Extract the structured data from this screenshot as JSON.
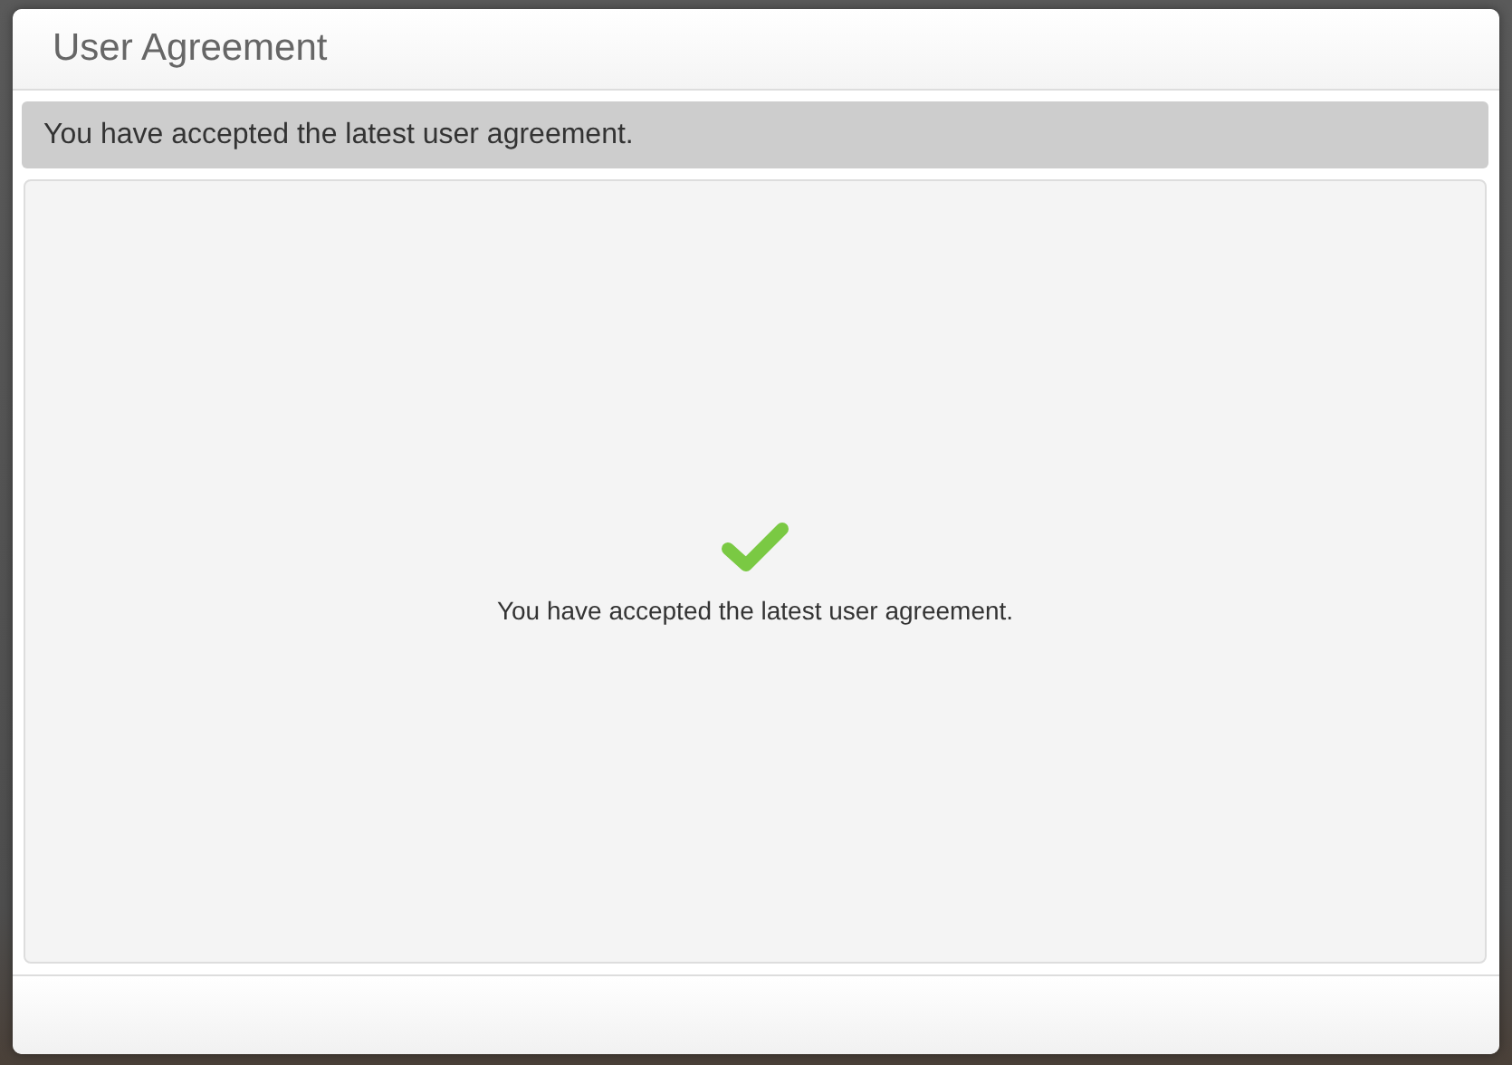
{
  "dialog": {
    "title": "User Agreement",
    "alert": "You have accepted the latest user agreement.",
    "status": {
      "kind": "success",
      "message": "You have accepted the latest user agreement."
    }
  }
}
